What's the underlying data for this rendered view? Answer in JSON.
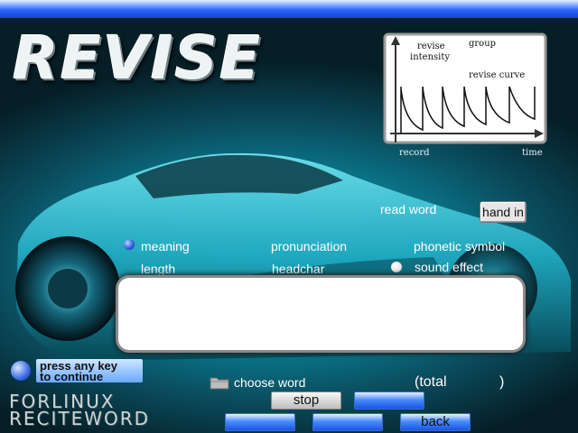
{
  "header": {
    "title": "REVISE"
  },
  "graph": {
    "y_label_1": "revise",
    "y_label_2": "intensity",
    "group_label": "group",
    "curve_label": "revise curve",
    "x_label_record": "record",
    "x_label_time": "time"
  },
  "controls": {
    "read_word": "read word",
    "hand_in": "hand in",
    "options": {
      "meaning": "meaning",
      "pronunciation": "pronunciation",
      "phonetic_symbol": "phonetic symbol",
      "length": "length",
      "headchar": "headchar",
      "sound_effect": "sound effect"
    }
  },
  "footer": {
    "press_line1": "press any key",
    "press_line2": "to continue",
    "choose_word": "choose word",
    "total_open": "(total",
    "total_close": ")",
    "stop": "stop",
    "back": "back",
    "brand_line1": "FORLINUX",
    "brand_line2": "RECITEWORD"
  },
  "colors": {
    "top_bar": "#2a66ff",
    "radio_selected": "#2a5ad8",
    "button_blue": "#4a8cff"
  }
}
